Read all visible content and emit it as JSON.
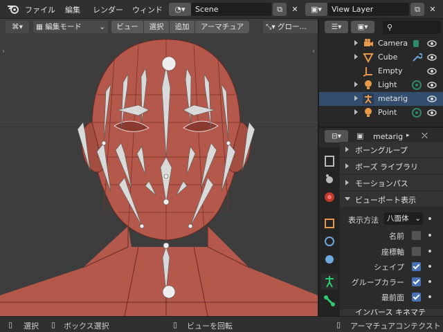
{
  "topbar": {
    "menus": [
      "ファイル",
      "編集",
      "レンダー",
      "ウィンド"
    ],
    "scene_label": "Scene",
    "view_layer_label": "View Layer"
  },
  "viewport": {
    "mode_label": "編集モード",
    "menu_view": "ビュー",
    "menu_select": "選択",
    "menu_add": "追加",
    "menu_armature": "アーマチュア",
    "orientation_label": "グロー…"
  },
  "outliner": {
    "items": [
      {
        "label": "Camera",
        "icon": "camera-icon",
        "extra": "camera-data-icon",
        "selected": false
      },
      {
        "label": "Cube",
        "icon": "mesh-cube-icon",
        "extra": "wrench-icon",
        "selected": false
      },
      {
        "label": "Empty",
        "icon": "empty-axes-icon",
        "extra": "",
        "selected": false
      },
      {
        "label": "Light",
        "icon": "light-icon",
        "extra": "light-data-icon",
        "selected": false
      },
      {
        "label": "metarig",
        "icon": "armature-icon",
        "extra": "",
        "selected": true
      },
      {
        "label": "Point",
        "icon": "light-icon",
        "extra": "light-data-icon",
        "selected": false
      }
    ]
  },
  "properties": {
    "object_name": "metarig",
    "panels": {
      "bone_groups": "ボーングループ",
      "pose_library": "ボーズ ライブラリ",
      "motion_paths": "モーションパス",
      "viewport_display": "ビューポート表示"
    },
    "display_as_label": "表示方法",
    "display_as_value": "八面体",
    "options": [
      {
        "label": "名前",
        "checked": false
      },
      {
        "label": "座標軸",
        "checked": false
      },
      {
        "label": "シェイプ",
        "checked": true
      },
      {
        "label": "グループカラー",
        "checked": true
      },
      {
        "label": "最前面",
        "checked": true
      }
    ],
    "bottom_panel_partial": "インバース キネマテ"
  },
  "statusbar": {
    "select": "選択",
    "box_select": "ボックス選択",
    "rotate_view": "ビューを回転",
    "context": "アーマチュアコンテクスト"
  },
  "colors": {
    "accent_blue": "#4772b3",
    "selected_row": "#334d6e",
    "face_skin": "#b3584a",
    "bone_white": "#e6e6e6"
  }
}
